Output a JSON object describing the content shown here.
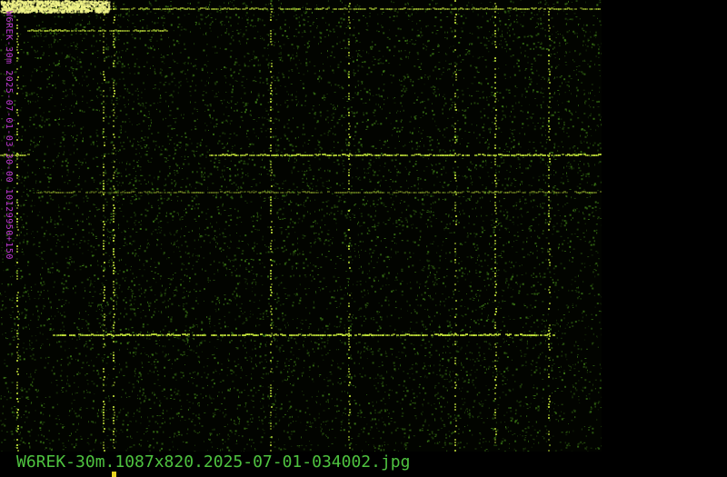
{
  "image": {
    "side_label": "W6REK-30m 2025-07-01-03-30-00 10129950+150",
    "caption": "W6REK-30m.1087x820.2025-07-01-034002.jpg"
  },
  "colors": {
    "background": "#000000",
    "noise": "#3f7f16",
    "signal": "#c6e63a",
    "label": "#c23ad6",
    "caption": "#4ec23f",
    "cursor": "#e6d21f"
  }
}
